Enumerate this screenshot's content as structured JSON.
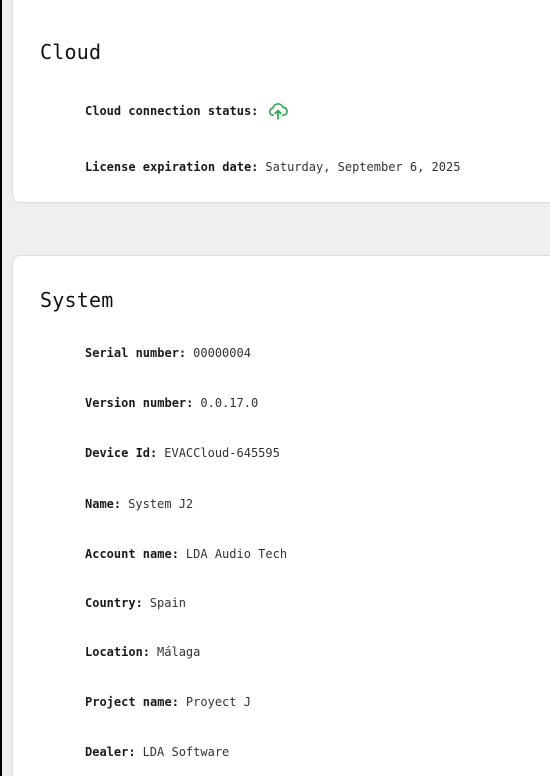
{
  "cloud": {
    "title": "Cloud",
    "status_label": "Cloud connection status:",
    "status_icon": "cloud-upload-icon",
    "status_color": "#2fa84f",
    "license_label": "License expiration date:",
    "license_value": "Saturday, September 6, 2025"
  },
  "system": {
    "title": "System",
    "fields": [
      {
        "label": "Serial number:",
        "value": "00000004"
      },
      {
        "label": "Version number:",
        "value": "0.0.17.0"
      },
      {
        "label": "Device Id:",
        "value": "EVACCloud-645595"
      },
      {
        "label": "Name:",
        "value": "System J2"
      },
      {
        "label": "Account name:",
        "value": "LDA Audio Tech"
      },
      {
        "label": "Country:",
        "value": "Spain"
      },
      {
        "label": "Location:",
        "value": "Málaga"
      },
      {
        "label": "Project name:",
        "value": "Proyect J"
      },
      {
        "label": "Dealer:",
        "value": "LDA Software"
      }
    ]
  }
}
